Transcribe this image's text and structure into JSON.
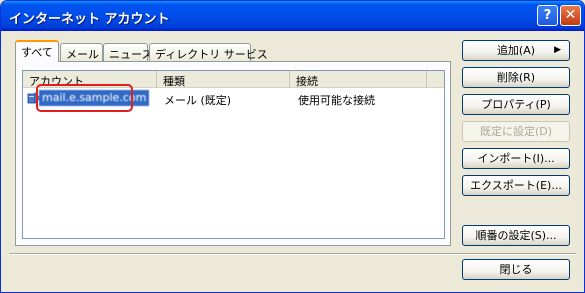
{
  "window": {
    "title": "インターネット アカウント"
  },
  "titlebar_buttons": {
    "help": "?",
    "close": "✕"
  },
  "tabs": [
    {
      "label": "すべて",
      "active": true
    },
    {
      "label": "メール",
      "active": false
    },
    {
      "label": "ニュース",
      "active": false
    },
    {
      "label": "ディレクトリ サービス",
      "active": false
    }
  ],
  "list": {
    "columns": [
      "アカウント",
      "種類",
      "接続"
    ],
    "rows": [
      {
        "account": "mail.e.sample.com",
        "type": "メール (既定)",
        "connection": "使用可能な接続",
        "selected": true
      }
    ]
  },
  "buttons": {
    "add": "追加(A)",
    "add_arrow": "▶",
    "remove": "削除(R)",
    "properties": "プロパティ(P)",
    "set_default": "既定に設定(D)",
    "import": "インポート(I)...",
    "export": "エクスポート(E)...",
    "order": "順番の設定(S)...",
    "close": "閉じる"
  },
  "colors": {
    "selection": "#316ac5",
    "highlight_annotation": "#e0201b",
    "titlebar": "#0053ee"
  }
}
